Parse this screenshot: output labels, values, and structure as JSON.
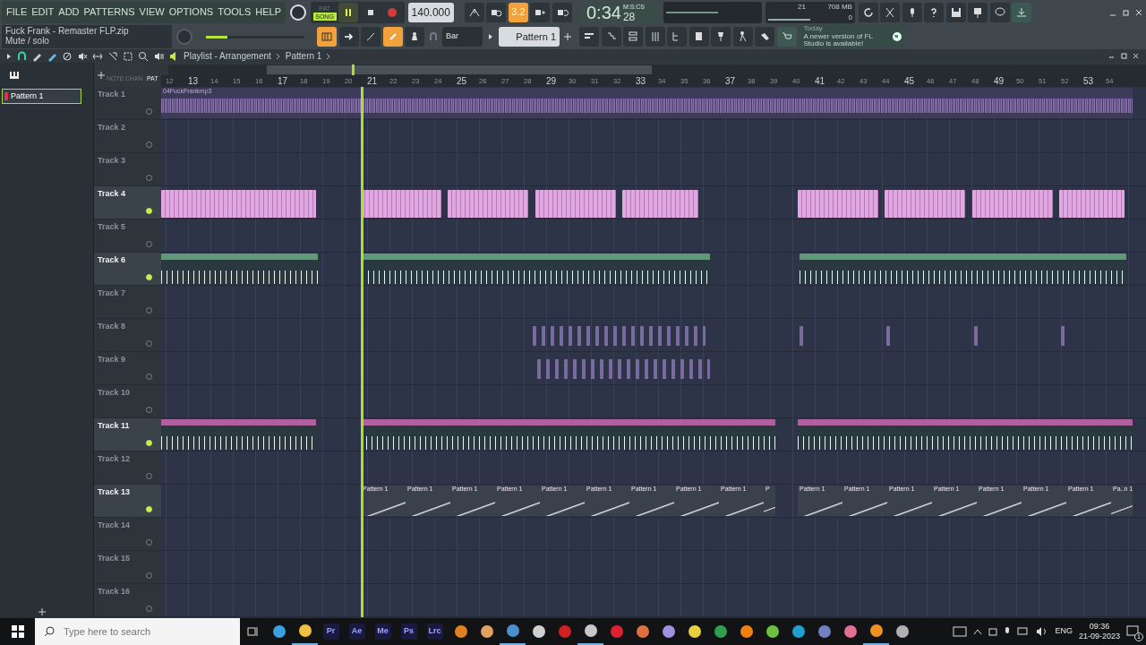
{
  "menu": [
    "FILE",
    "EDIT",
    "ADD",
    "PATTERNS",
    "VIEW",
    "OPTIONS",
    "TOOLS",
    "HELP"
  ],
  "transport": {
    "pat_label": "PAT",
    "song_label": "SONG",
    "song_mode": true,
    "playing": true,
    "recording": false,
    "tempo": "140.000"
  },
  "mode_buttons": [
    {
      "kind": "icon",
      "on": false
    },
    {
      "kind": "icon",
      "on": false
    },
    {
      "kind": "text",
      "label": "3.2",
      "on": true
    },
    {
      "kind": "icon",
      "on": false
    },
    {
      "kind": "icon",
      "on": false
    }
  ],
  "time": {
    "main": "0:34",
    "small": "28",
    "unit": "M:S:CS"
  },
  "monitor": {
    "cpu": "21",
    "memory": "708 MB",
    "polyphony": "0"
  },
  "hint": {
    "file": "Fuck Frank - Remaster FLP.zip",
    "text": "Mute / solo"
  },
  "master": {
    "level": 0.22
  },
  "edit_buttons": [
    {
      "on": true
    },
    {
      "on": false
    },
    {
      "on": false
    },
    {
      "on": true
    },
    {
      "on": false
    }
  ],
  "snap": "Bar",
  "pattern_selector": "Pattern 1",
  "news": {
    "when": "Today",
    "text": "A newer version of FL Studio is available!"
  },
  "playlist": {
    "title": "Playlist - Arrangement",
    "pattern": "Pattern 1",
    "browser_items": [
      {
        "label": "Pattern 1",
        "selected": true
      }
    ],
    "tool_labels": [
      "NOTE",
      "CHAN",
      "PAT"
    ],
    "ruler": [
      "12",
      "13",
      "14",
      "15",
      "16",
      "17",
      "18",
      "19",
      "20",
      "21",
      "22",
      "23",
      "24",
      "25",
      "26",
      "27",
      "28",
      "29",
      "30",
      "31",
      "32",
      "33",
      "34",
      "35",
      "36",
      "37",
      "38",
      "39",
      "40",
      "41",
      "42",
      "43",
      "44",
      "45",
      "46",
      "47",
      "48",
      "49",
      "50",
      "51",
      "52",
      "53",
      "54"
    ],
    "tracks": [
      {
        "name": "Track 1",
        "active": false,
        "clips": [
          {
            "kind": "audio",
            "color": "#8a78ad",
            "label": "04FuckFrankmp3"
          }
        ]
      },
      {
        "name": "Track 2",
        "active": false
      },
      {
        "name": "Track 3",
        "active": false
      },
      {
        "name": "Track 4",
        "active": true,
        "clips": [
          {
            "kind": "notes",
            "color": "#e0a8e0"
          },
          {
            "kind": "notes",
            "color": "#e0a8e0"
          },
          {
            "kind": "notes",
            "color": "#e0a8e0"
          },
          {
            "kind": "notes",
            "color": "#e0a8e0"
          },
          {
            "kind": "notes",
            "color": "#e0a8e0"
          },
          {
            "kind": "notes",
            "color": "#e0a8e0"
          },
          {
            "kind": "notes",
            "color": "#e0a8e0"
          },
          {
            "kind": "notes",
            "color": "#e0a8e0"
          },
          {
            "kind": "notes",
            "color": "#e0a8e0"
          }
        ]
      },
      {
        "name": "Track 5",
        "active": false
      },
      {
        "name": "Track 6",
        "active": true,
        "clips": [
          {
            "kind": "hits",
            "color": "#5f9a78"
          },
          {
            "kind": "hits",
            "color": "#5f9a78"
          },
          {
            "kind": "hits",
            "color": "#5f9a78"
          }
        ]
      },
      {
        "name": "Track 7",
        "active": false
      },
      {
        "name": "Track 8",
        "active": false,
        "clips": [
          {
            "kind": "faded",
            "color": "#7a6a9e"
          },
          {
            "kind": "faded",
            "color": "#7a6a9e"
          },
          {
            "kind": "faded",
            "color": "#7a6a9e"
          },
          {
            "kind": "faded",
            "color": "#7a6a9e"
          },
          {
            "kind": "faded",
            "color": "#7a6a9e"
          }
        ]
      },
      {
        "name": "Track 9",
        "active": false,
        "clips": [
          {
            "kind": "faded",
            "color": "#7a6a9e"
          }
        ]
      },
      {
        "name": "Track 10",
        "active": false
      },
      {
        "name": "Track 11",
        "active": true,
        "clips": [
          {
            "kind": "hits",
            "color": "#b0609f"
          },
          {
            "kind": "hits",
            "color": "#b0609f"
          },
          {
            "kind": "hits",
            "color": "#b0609f"
          }
        ]
      },
      {
        "name": "Track 12",
        "active": false
      },
      {
        "name": "Track 13",
        "active": true,
        "clips": [
          {
            "kind": "automation",
            "color": "#3a414d",
            "label": "Pattern 1"
          },
          {
            "kind": "automation",
            "color": "#3a414d",
            "label": "Pattern 1"
          },
          {
            "kind": "automation",
            "color": "#3a414d",
            "label": "Pattern 1"
          },
          {
            "kind": "automation",
            "color": "#3a414d",
            "label": "Pattern 1"
          },
          {
            "kind": "automation",
            "color": "#3a414d",
            "label": "Pattern 1"
          },
          {
            "kind": "automation",
            "color": "#3a414d",
            "label": "Pattern 1"
          },
          {
            "kind": "automation",
            "color": "#3a414d",
            "label": "Pattern 1"
          },
          {
            "kind": "automation",
            "color": "#3a414d",
            "label": "Pattern 1"
          },
          {
            "kind": "automation",
            "color": "#3a414d",
            "label": "Pattern 1"
          },
          {
            "kind": "automation",
            "color": "#3a414d",
            "label": "P"
          },
          {
            "kind": "automation",
            "color": "#3a414d",
            "label": "Pattern 1"
          },
          {
            "kind": "automation",
            "color": "#3a414d",
            "label": "Pattern 1"
          },
          {
            "kind": "automation",
            "color": "#3a414d",
            "label": "Pattern 1"
          },
          {
            "kind": "automation",
            "color": "#3a414d",
            "label": "Pattern 1"
          },
          {
            "kind": "automation",
            "color": "#3a414d",
            "label": "Pattern 1"
          },
          {
            "kind": "automation",
            "color": "#3a414d",
            "label": "Pattern 1"
          },
          {
            "kind": "automation",
            "color": "#3a414d",
            "label": "Pattern 1"
          },
          {
            "kind": "automation",
            "color": "#3a414d",
            "label": "Pa..n 1"
          }
        ]
      },
      {
        "name": "Track 14",
        "active": false
      },
      {
        "name": "Track 15",
        "active": false
      },
      {
        "name": "Track 16",
        "active": false
      }
    ]
  },
  "taskbar": {
    "search_placeholder": "Type here to search",
    "apps": [
      {
        "kind": "icon",
        "color": "#3aa0e0",
        "running": false
      },
      {
        "kind": "icon",
        "color": "#f0c040",
        "running": true
      },
      {
        "kind": "text",
        "label": "Pr",
        "running": false
      },
      {
        "kind": "text",
        "label": "Ae",
        "running": false
      },
      {
        "kind": "text",
        "label": "Me",
        "running": false
      },
      {
        "kind": "text",
        "label": "Ps",
        "running": false
      },
      {
        "kind": "text",
        "label": "Lrc",
        "running": false
      },
      {
        "kind": "icon",
        "color": "#e08020",
        "running": false
      },
      {
        "kind": "icon",
        "color": "#e0a060",
        "running": false
      },
      {
        "kind": "icon",
        "color": "#4a90d0",
        "running": true
      },
      {
        "kind": "icon",
        "color": "#d0d0d0",
        "running": false
      },
      {
        "kind": "icon",
        "color": "#d02020",
        "running": false
      },
      {
        "kind": "icon",
        "color": "#c8c8c8",
        "running": true
      },
      {
        "kind": "icon",
        "color": "#e02030",
        "running": false
      },
      {
        "kind": "icon",
        "color": "#e07040",
        "running": false
      },
      {
        "kind": "icon",
        "color": "#a090e0",
        "running": false
      },
      {
        "kind": "icon",
        "color": "#e8d040",
        "running": false
      },
      {
        "kind": "icon",
        "color": "#30a050",
        "running": false
      },
      {
        "kind": "icon",
        "color": "#f08010",
        "running": false
      },
      {
        "kind": "icon",
        "color": "#70c040",
        "running": false
      },
      {
        "kind": "icon",
        "color": "#20a0d0",
        "running": false
      },
      {
        "kind": "icon",
        "color": "#7080c0",
        "running": false
      },
      {
        "kind": "icon",
        "color": "#e07090",
        "running": false
      },
      {
        "kind": "icon",
        "color": "#f09020",
        "running": true
      },
      {
        "kind": "icon",
        "color": "#b0b0b0",
        "running": false
      }
    ],
    "language": "ENG",
    "time": "09:36",
    "date": "21-09-2023",
    "notifications": "1"
  }
}
